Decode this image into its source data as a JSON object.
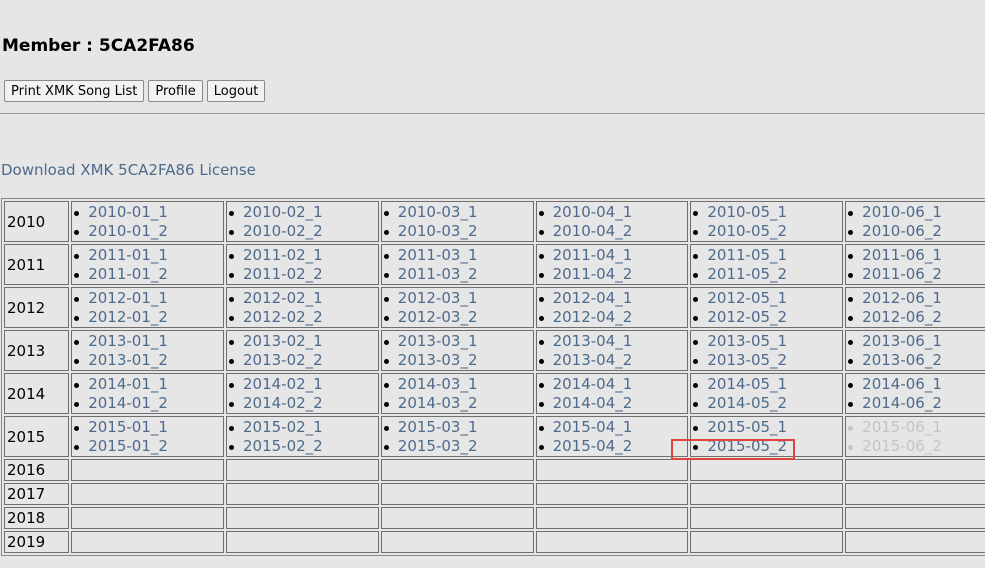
{
  "header": {
    "member_title": "Member : 5CA2FA86"
  },
  "toolbar": {
    "print_label": "Print XMK Song List",
    "profile_label": "Profile",
    "logout_label": "Logout"
  },
  "license": {
    "link_text": "Download XMK 5CA2FA86 License"
  },
  "grid": {
    "rows": [
      {
        "year": "2010",
        "months": [
          {
            "links": [
              "2010-01_1",
              "2010-01_2"
            ],
            "disabled": false
          },
          {
            "links": [
              "2010-02_1",
              "2010-02_2"
            ],
            "disabled": false
          },
          {
            "links": [
              "2010-03_1",
              "2010-03_2"
            ],
            "disabled": false
          },
          {
            "links": [
              "2010-04_1",
              "2010-04_2"
            ],
            "disabled": false
          },
          {
            "links": [
              "2010-05_1",
              "2010-05_2"
            ],
            "disabled": false
          },
          {
            "links": [
              "2010-06_1",
              "2010-06_2"
            ],
            "disabled": false
          }
        ]
      },
      {
        "year": "2011",
        "months": [
          {
            "links": [
              "2011-01_1",
              "2011-01_2"
            ],
            "disabled": false
          },
          {
            "links": [
              "2011-02_1",
              "2011-02_2"
            ],
            "disabled": false
          },
          {
            "links": [
              "2011-03_1",
              "2011-03_2"
            ],
            "disabled": false
          },
          {
            "links": [
              "2011-04_1",
              "2011-04_2"
            ],
            "disabled": false
          },
          {
            "links": [
              "2011-05_1",
              "2011-05_2"
            ],
            "disabled": false
          },
          {
            "links": [
              "2011-06_1",
              "2011-06_2"
            ],
            "disabled": false
          }
        ]
      },
      {
        "year": "2012",
        "months": [
          {
            "links": [
              "2012-01_1",
              "2012-01_2"
            ],
            "disabled": false
          },
          {
            "links": [
              "2012-02_1",
              "2012-02_2"
            ],
            "disabled": false
          },
          {
            "links": [
              "2012-03_1",
              "2012-03_2"
            ],
            "disabled": false
          },
          {
            "links": [
              "2012-04_1",
              "2012-04_2"
            ],
            "disabled": false
          },
          {
            "links": [
              "2012-05_1",
              "2012-05_2"
            ],
            "disabled": false
          },
          {
            "links": [
              "2012-06_1",
              "2012-06_2"
            ],
            "disabled": false
          }
        ]
      },
      {
        "year": "2013",
        "months": [
          {
            "links": [
              "2013-01_1",
              "2013-01_2"
            ],
            "disabled": false
          },
          {
            "links": [
              "2013-02_1",
              "2013-02_2"
            ],
            "disabled": false
          },
          {
            "links": [
              "2013-03_1",
              "2013-03_2"
            ],
            "disabled": false
          },
          {
            "links": [
              "2013-04_1",
              "2013-04_2"
            ],
            "disabled": false
          },
          {
            "links": [
              "2013-05_1",
              "2013-05_2"
            ],
            "disabled": false
          },
          {
            "links": [
              "2013-06_1",
              "2013-06_2"
            ],
            "disabled": false
          }
        ]
      },
      {
        "year": "2014",
        "months": [
          {
            "links": [
              "2014-01_1",
              "2014-01_2"
            ],
            "disabled": false
          },
          {
            "links": [
              "2014-02_1",
              "2014-02_2"
            ],
            "disabled": false
          },
          {
            "links": [
              "2014-03_1",
              "2014-03_2"
            ],
            "disabled": false
          },
          {
            "links": [
              "2014-04_1",
              "2014-04_2"
            ],
            "disabled": false
          },
          {
            "links": [
              "2014-05_1",
              "2014-05_2"
            ],
            "disabled": false
          },
          {
            "links": [
              "2014-06_1",
              "2014-06_2"
            ],
            "disabled": false
          }
        ]
      },
      {
        "year": "2015",
        "months": [
          {
            "links": [
              "2015-01_1",
              "2015-01_2"
            ],
            "disabled": false
          },
          {
            "links": [
              "2015-02_1",
              "2015-02_2"
            ],
            "disabled": false
          },
          {
            "links": [
              "2015-03_1",
              "2015-03_2"
            ],
            "disabled": false
          },
          {
            "links": [
              "2015-04_1",
              "2015-04_2"
            ],
            "disabled": false
          },
          {
            "links": [
              "2015-05_1",
              "2015-05_2"
            ],
            "disabled": false
          },
          {
            "links": [
              "2015-06_1",
              "2015-06_2"
            ],
            "disabled": true
          }
        ]
      }
    ],
    "empty_years": [
      "2016",
      "2017",
      "2018",
      "2019"
    ],
    "highlighted_link": "2015-05_2",
    "highlight_color": "#e0443e",
    "link_color": "#4e6a8c",
    "disabled_color": "#c4c4c4"
  }
}
